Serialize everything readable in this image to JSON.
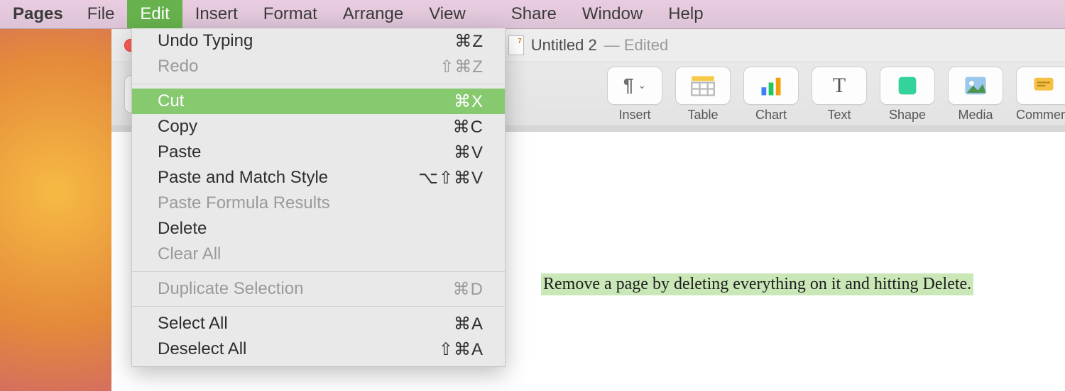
{
  "menubar": {
    "app": "Pages",
    "items": [
      "File",
      "Edit",
      "Insert",
      "Format",
      "Arrange",
      "View",
      "Share",
      "Window",
      "Help"
    ],
    "open_index": 1
  },
  "edit_menu": {
    "items": [
      {
        "label": "Undo Typing",
        "shortcut": "⌘Z",
        "disabled": false
      },
      {
        "label": "Redo",
        "shortcut": "⇧⌘Z",
        "disabled": true
      },
      {
        "sep": true
      },
      {
        "label": "Cut",
        "shortcut": "⌘X",
        "highlight": true
      },
      {
        "label": "Copy",
        "shortcut": "⌘C"
      },
      {
        "label": "Paste",
        "shortcut": "⌘V"
      },
      {
        "label": "Paste and Match Style",
        "shortcut": "⌥⇧⌘V"
      },
      {
        "label": "Paste Formula Results",
        "shortcut": "",
        "disabled": true
      },
      {
        "label": "Delete",
        "shortcut": ""
      },
      {
        "label": "Clear All",
        "shortcut": "",
        "disabled": true
      },
      {
        "sep": true
      },
      {
        "label": "Duplicate Selection",
        "shortcut": "⌘D",
        "disabled": true
      },
      {
        "sep": true
      },
      {
        "label": "Select All",
        "shortcut": "⌘A"
      },
      {
        "label": "Deselect All",
        "shortcut": "⇧⌘A"
      }
    ]
  },
  "window": {
    "title": "Untitled 2",
    "edited_suffix": " — Edited"
  },
  "toolbar": {
    "buttons": [
      {
        "id": "insert",
        "label": "Insert",
        "icon": "pilcrow"
      },
      {
        "id": "table",
        "label": "Table",
        "icon": "table"
      },
      {
        "id": "chart",
        "label": "Chart",
        "icon": "chart"
      },
      {
        "id": "text",
        "label": "Text",
        "icon": "text"
      },
      {
        "id": "shape",
        "label": "Shape",
        "icon": "shape"
      },
      {
        "id": "media",
        "label": "Media",
        "icon": "media"
      },
      {
        "id": "comment",
        "label": "Comment",
        "icon": "comment"
      }
    ]
  },
  "document": {
    "selected_text": "Remove a page by deleting everything on it and hitting Delete."
  }
}
